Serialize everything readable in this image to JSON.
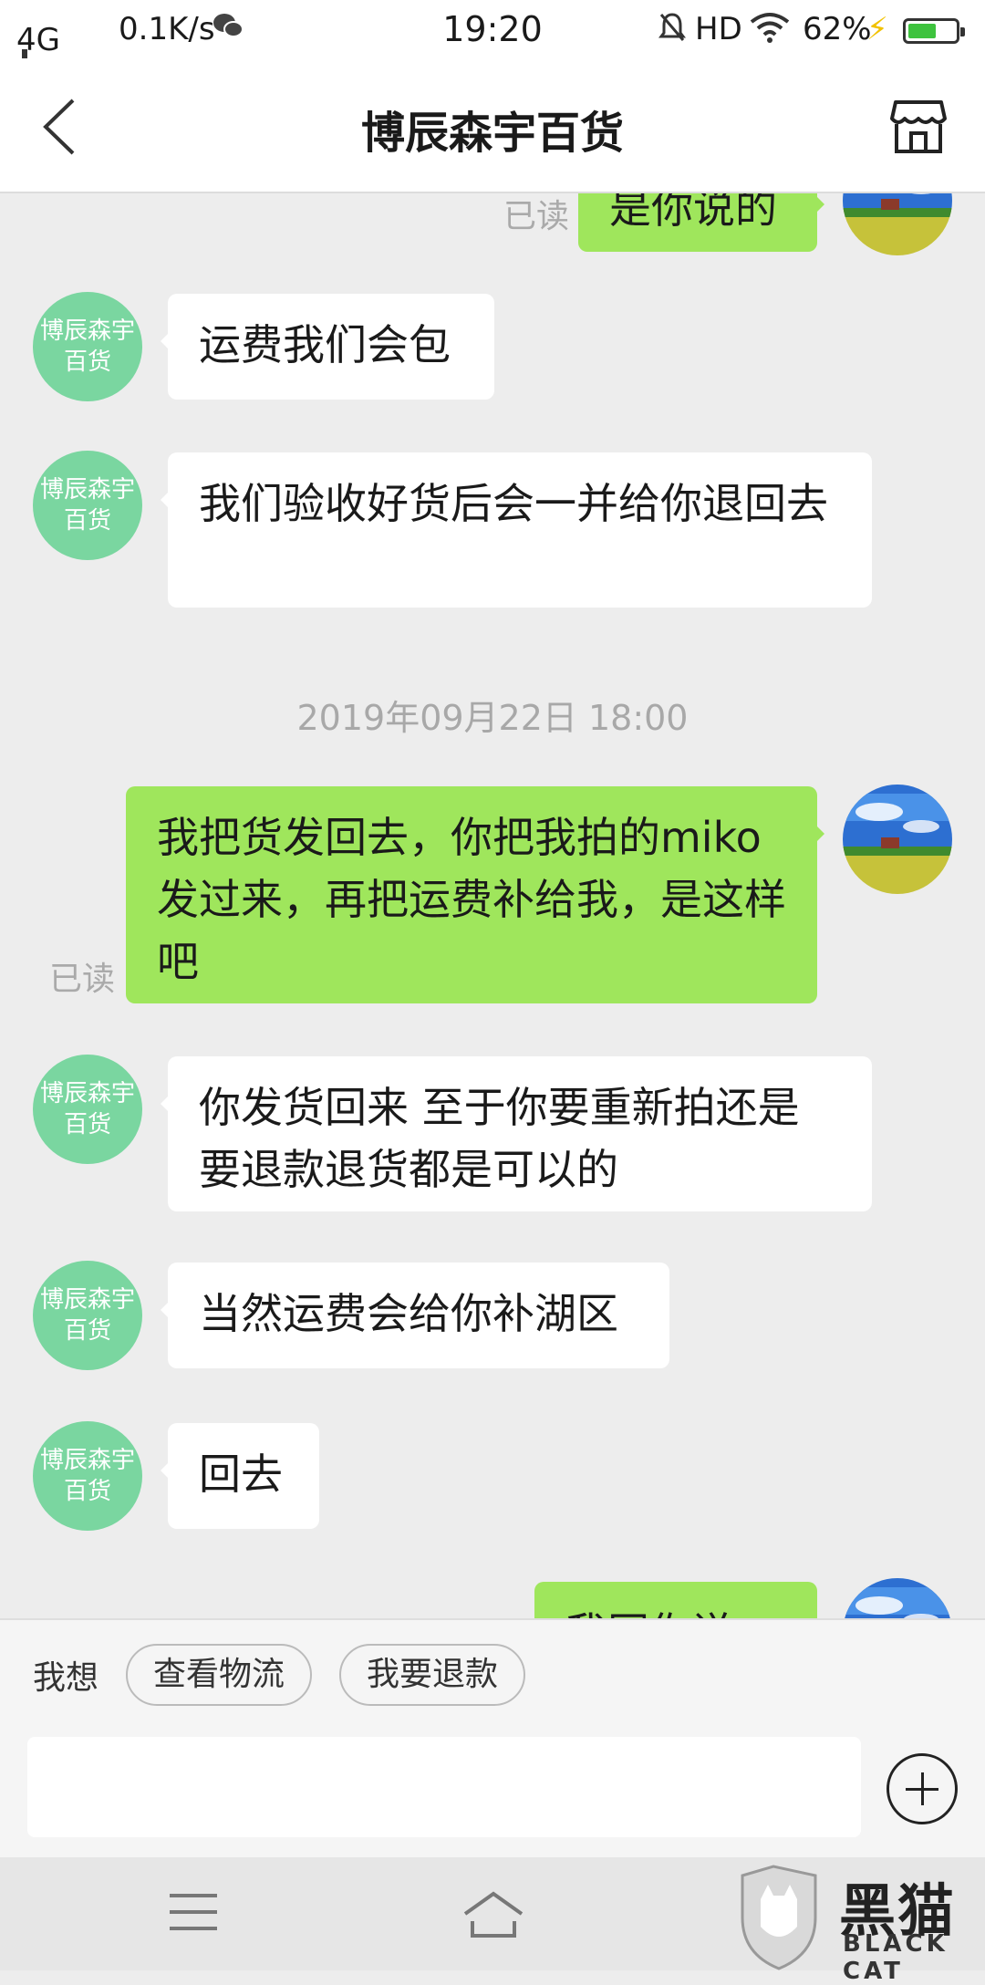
{
  "status_bar": {
    "network": "4G",
    "speed": "0.1K/s",
    "time": "19:20",
    "hd": "HD",
    "battery": "62%"
  },
  "header": {
    "title": "博辰森宇百货"
  },
  "shop_avatar_text": "博辰森宇百货",
  "messages": [
    {
      "side": "out",
      "text": "是你说的",
      "status": "已读"
    },
    {
      "side": "in",
      "text": "运费我们会包"
    },
    {
      "side": "in",
      "text": "我们验收好货后会一并给你退回去"
    },
    {
      "timestamp": "2019年09月22日 18:00"
    },
    {
      "side": "out",
      "text": "我把货发回去，你把我拍的miko发过来，再把运费补给我，是这样吧",
      "status": "已读"
    },
    {
      "side": "in",
      "text": "你发货回来  至于你要重新拍还是要退款退货都是可以的"
    },
    {
      "side": "in",
      "text": "当然运费会给你补湖区"
    },
    {
      "side": "in",
      "text": "回去"
    },
    {
      "side": "out",
      "text": "我同你说"
    }
  ],
  "quick_actions": {
    "label": "我想",
    "chips": [
      "查看物流",
      "我要退款"
    ]
  },
  "input": {
    "placeholder": ""
  },
  "watermark": {
    "text": "黑猫",
    "sub": "BLACK CAT"
  },
  "colors": {
    "out_bubble": "#9fe65c",
    "in_bubble": "#ffffff",
    "shop_avatar": "#7ad6a0",
    "background": "#ededed"
  }
}
